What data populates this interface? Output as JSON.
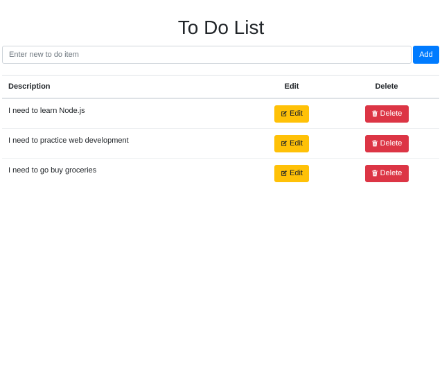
{
  "page": {
    "title": "To Do List"
  },
  "new_item": {
    "placeholder": "Enter new to do item",
    "value": "",
    "add_label": "Add"
  },
  "table": {
    "headers": {
      "description": "Description",
      "edit": "Edit",
      "delete": "Delete"
    },
    "rows": [
      {
        "description": "I need to learn Node.js",
        "edit_label": "Edit",
        "delete_label": "Delete"
      },
      {
        "description": "I need to practice web development",
        "edit_label": "Edit",
        "delete_label": "Delete"
      },
      {
        "description": "I need to go buy groceries",
        "edit_label": "Edit",
        "delete_label": "Delete"
      }
    ]
  },
  "icons": {
    "edit": "pencil-square-icon",
    "delete": "trash-icon"
  },
  "colors": {
    "primary": "#007bff",
    "warning": "#ffc107",
    "danger": "#dc3545"
  }
}
